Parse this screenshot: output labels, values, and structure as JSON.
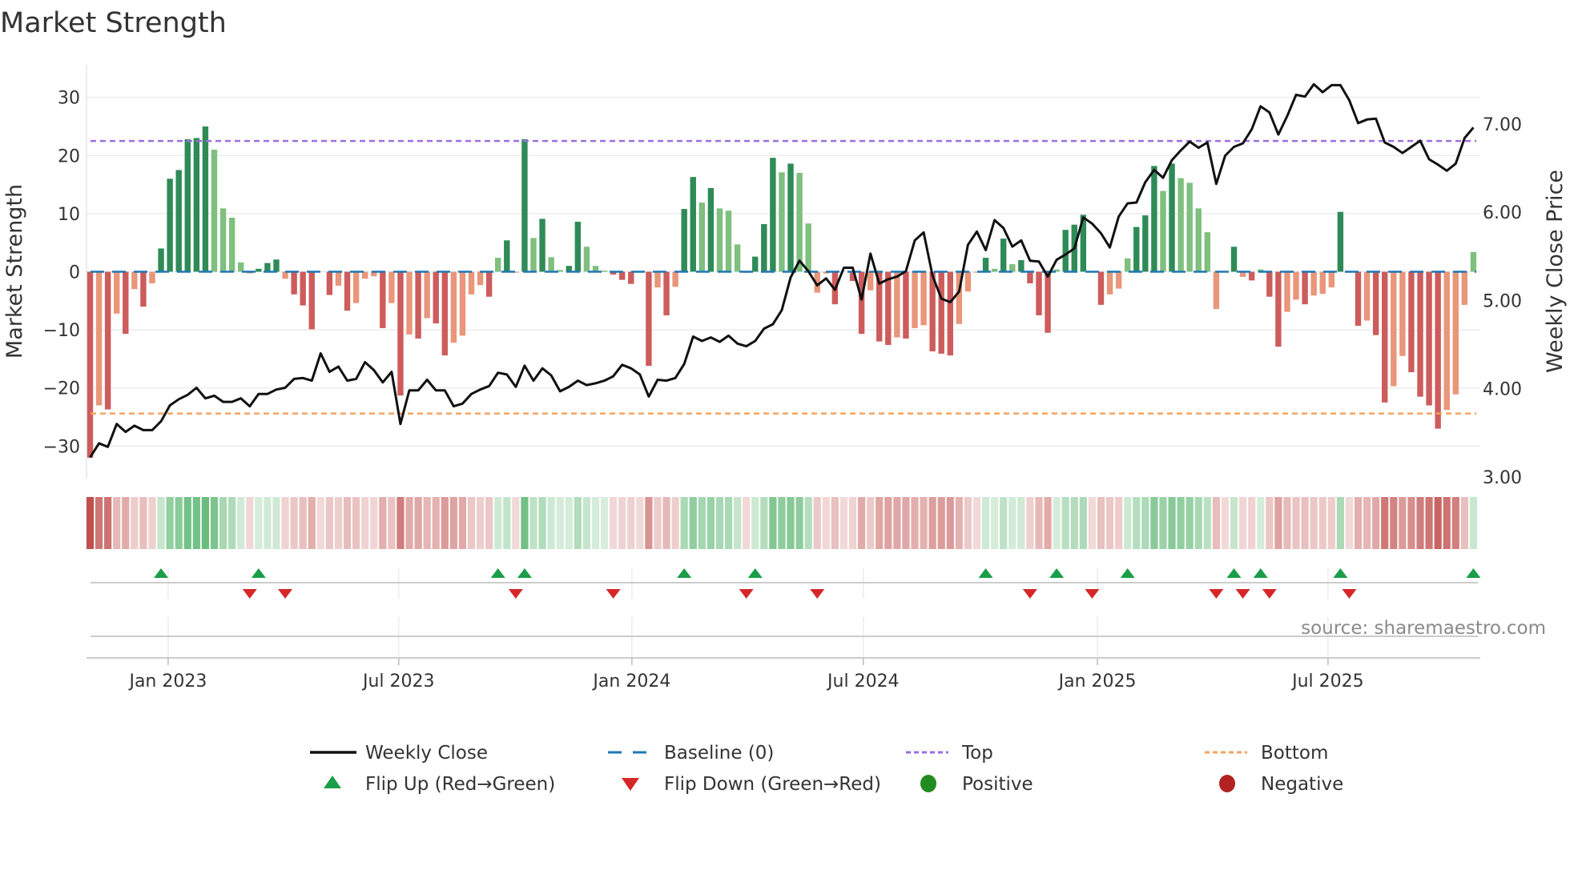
{
  "chart_data": {
    "type": "bar+line",
    "title": "Market Strength",
    "ylabel_left": "Market Strength",
    "ylabel_right": "Weekly Close Price",
    "source": "source: sharemaestro.com",
    "left_ticks": [
      30,
      20,
      10,
      0,
      -10,
      -20,
      -30
    ],
    "left_tick_labels": [
      "30",
      "20",
      "10",
      "0",
      "−10",
      "−20",
      "−30"
    ],
    "right_ticks": [
      7,
      6,
      5,
      4,
      3
    ],
    "right_tick_labels": [
      "7.00",
      "6.00",
      "5.00",
      "4.00",
      "3.00"
    ],
    "ylim_left": [
      -35.6,
      35.6
    ],
    "ylim_right": [
      2.98,
      7.67
    ],
    "x_ticks": [
      {
        "label": "Jan 2023",
        "week": 8.8
      },
      {
        "label": "Jul 2023",
        "week": 34.8
      },
      {
        "label": "Jan 2024",
        "week": 61.1
      },
      {
        "label": "Jul 2024",
        "week": 87.2
      },
      {
        "label": "Jan 2025",
        "week": 113.6
      },
      {
        "label": "Jul 2025",
        "week": 139.6
      }
    ],
    "top_level": 22.5,
    "bottom_level": -24.4,
    "baseline": 0,
    "strength": [
      -32,
      -23,
      -23.7,
      -7.2,
      -10.7,
      -3,
      -6,
      -2,
      4,
      16,
      17.5,
      22.8,
      23,
      25,
      21,
      10.9,
      9.3,
      1.6,
      -0.3,
      0.5,
      1.5,
      2.1,
      -1.2,
      -3.9,
      -5.8,
      -9.9,
      0,
      -4,
      -2.4,
      -6.7,
      -5.4,
      -1.2,
      -0.8,
      -9.7,
      -5.4,
      -21.3,
      -10.8,
      -11.5,
      -8,
      -8.9,
      -14.4,
      -12.2,
      -11,
      -3.9,
      -2.3,
      -4.3,
      2.4,
      5.4,
      -0.1,
      22.8,
      5.8,
      9.1,
      2.5,
      0.3,
      1,
      8.6,
      4.3,
      1,
      0.2,
      -0.5,
      -1.4,
      -2.1,
      0,
      -16.2,
      -2.7,
      -7.5,
      -2.6,
      10.8,
      16.3,
      11.9,
      14.4,
      10.9,
      10.5,
      4.7,
      -0.2,
      2.6,
      8.2,
      19.6,
      17.1,
      18.6,
      17,
      8.3,
      -3.6,
      -0.3,
      -5.6,
      0,
      -1.6,
      -10.7,
      -3.2,
      -12,
      -12.6,
      -11.3,
      -11.5,
      -9.7,
      -9.2,
      -13.7,
      -14.1,
      -14.4,
      -9,
      -3.4,
      -0.1,
      2.4,
      0.5,
      5.7,
      1.3,
      2,
      -2,
      -7.5,
      -10.5,
      0.4,
      7.2,
      8.1,
      9.8,
      -0.1,
      -5.7,
      -3.9,
      -2.9,
      2.3,
      7.7,
      9.7,
      18.2,
      13.9,
      18.6,
      16.1,
      15.3,
      10.9,
      6.8,
      -6.4,
      0,
      4.3,
      -0.9,
      -1.5,
      0.4,
      -4.3,
      -12.9,
      -6.9,
      -4.8,
      -5.6,
      -4.1,
      -3.8,
      -2.7,
      10.3,
      -0.1,
      -9.3,
      -8.4,
      -10.9,
      -22.5,
      -19.7,
      -14.5,
      -17.3,
      -21.5,
      -23,
      -27,
      -23.8,
      -21.1,
      -5.7,
      3.4
    ],
    "weekly_close": [
      3.22,
      3.38,
      3.34,
      3.6,
      3.51,
      3.58,
      3.53,
      3.53,
      3.63,
      3.81,
      3.88,
      3.93,
      4.01,
      3.89,
      3.92,
      3.85,
      3.85,
      3.89,
      3.8,
      3.94,
      3.94,
      3.99,
      4.01,
      4.11,
      4.12,
      4.09,
      4.4,
      4.19,
      4.25,
      4.09,
      4.11,
      4.3,
      4.21,
      4.07,
      4.19,
      3.6,
      3.98,
      3.98,
      4.1,
      3.98,
      3.98,
      3.8,
      3.83,
      3.94,
      3.99,
      4.03,
      4.18,
      4.16,
      4.02,
      4.26,
      4.09,
      4.23,
      4.15,
      3.97,
      4.02,
      4.09,
      4.04,
      4.06,
      4.09,
      4.14,
      4.27,
      4.23,
      4.16,
      3.91,
      4.1,
      4.09,
      4.12,
      4.28,
      4.59,
      4.54,
      4.58,
      4.53,
      4.6,
      4.51,
      4.48,
      4.54,
      4.68,
      4.73,
      4.89,
      5.26,
      5.45,
      5.33,
      5.17,
      5.25,
      5.12,
      5.37,
      5.37,
      5.01,
      5.53,
      5.19,
      5.24,
      5.27,
      5.33,
      5.68,
      5.77,
      5.28,
      5.02,
      4.98,
      5.1,
      5.63,
      5.78,
      5.57,
      5.91,
      5.82,
      5.61,
      5.68,
      5.45,
      5.44,
      5.27,
      5.46,
      5.52,
      5.59,
      5.94,
      5.87,
      5.76,
      5.6,
      5.95,
      6.1,
      6.11,
      6.34,
      6.48,
      6.39,
      6.59,
      6.7,
      6.8,
      6.73,
      6.79,
      6.32,
      6.64,
      6.74,
      6.78,
      6.94,
      7.2,
      7.13,
      6.88,
      7.09,
      7.33,
      7.31,
      7.45,
      7.36,
      7.44,
      7.44,
      7.27,
      7.01,
      7.05,
      7.06,
      6.79,
      6.74,
      6.67,
      6.74,
      6.81,
      6.6,
      6.54,
      6.47,
      6.55,
      6.84,
      6.96
    ],
    "flip_up_weeks": [
      8,
      19,
      46,
      49,
      67,
      75,
      101,
      109,
      117,
      129,
      132,
      141,
      156
    ],
    "flip_down_weeks": [
      18,
      22,
      48,
      59,
      74,
      82,
      106,
      113,
      127,
      130,
      133,
      142
    ],
    "legend": [
      {
        "label": "Weekly Close",
        "kind": "line",
        "color": "#111111"
      },
      {
        "label": "Baseline (0)",
        "kind": "dash",
        "color": "#1f77b4"
      },
      {
        "label": "Top",
        "kind": "dot",
        "color": "#9b6fe0"
      },
      {
        "label": "Bottom",
        "kind": "dot",
        "color": "#f4a460"
      },
      {
        "label": "Flip Up (Red→Green)",
        "kind": "up",
        "color": "#1a9e48"
      },
      {
        "label": "Flip Down (Green→Red)",
        "kind": "down",
        "color": "#d62728"
      },
      {
        "label": "Positive",
        "kind": "circle",
        "color": "#228b22"
      },
      {
        "label": "Negative",
        "kind": "circle",
        "color": "#b22222"
      }
    ],
    "colors": {
      "pos_strong": "#2e8b57",
      "pos_weak": "#7fbf7f",
      "neg_strong": "#cd5c5c",
      "neg_weak": "#e9967a",
      "heat_pos": "#4caf64",
      "heat_neg": "#c0504d"
    }
  }
}
